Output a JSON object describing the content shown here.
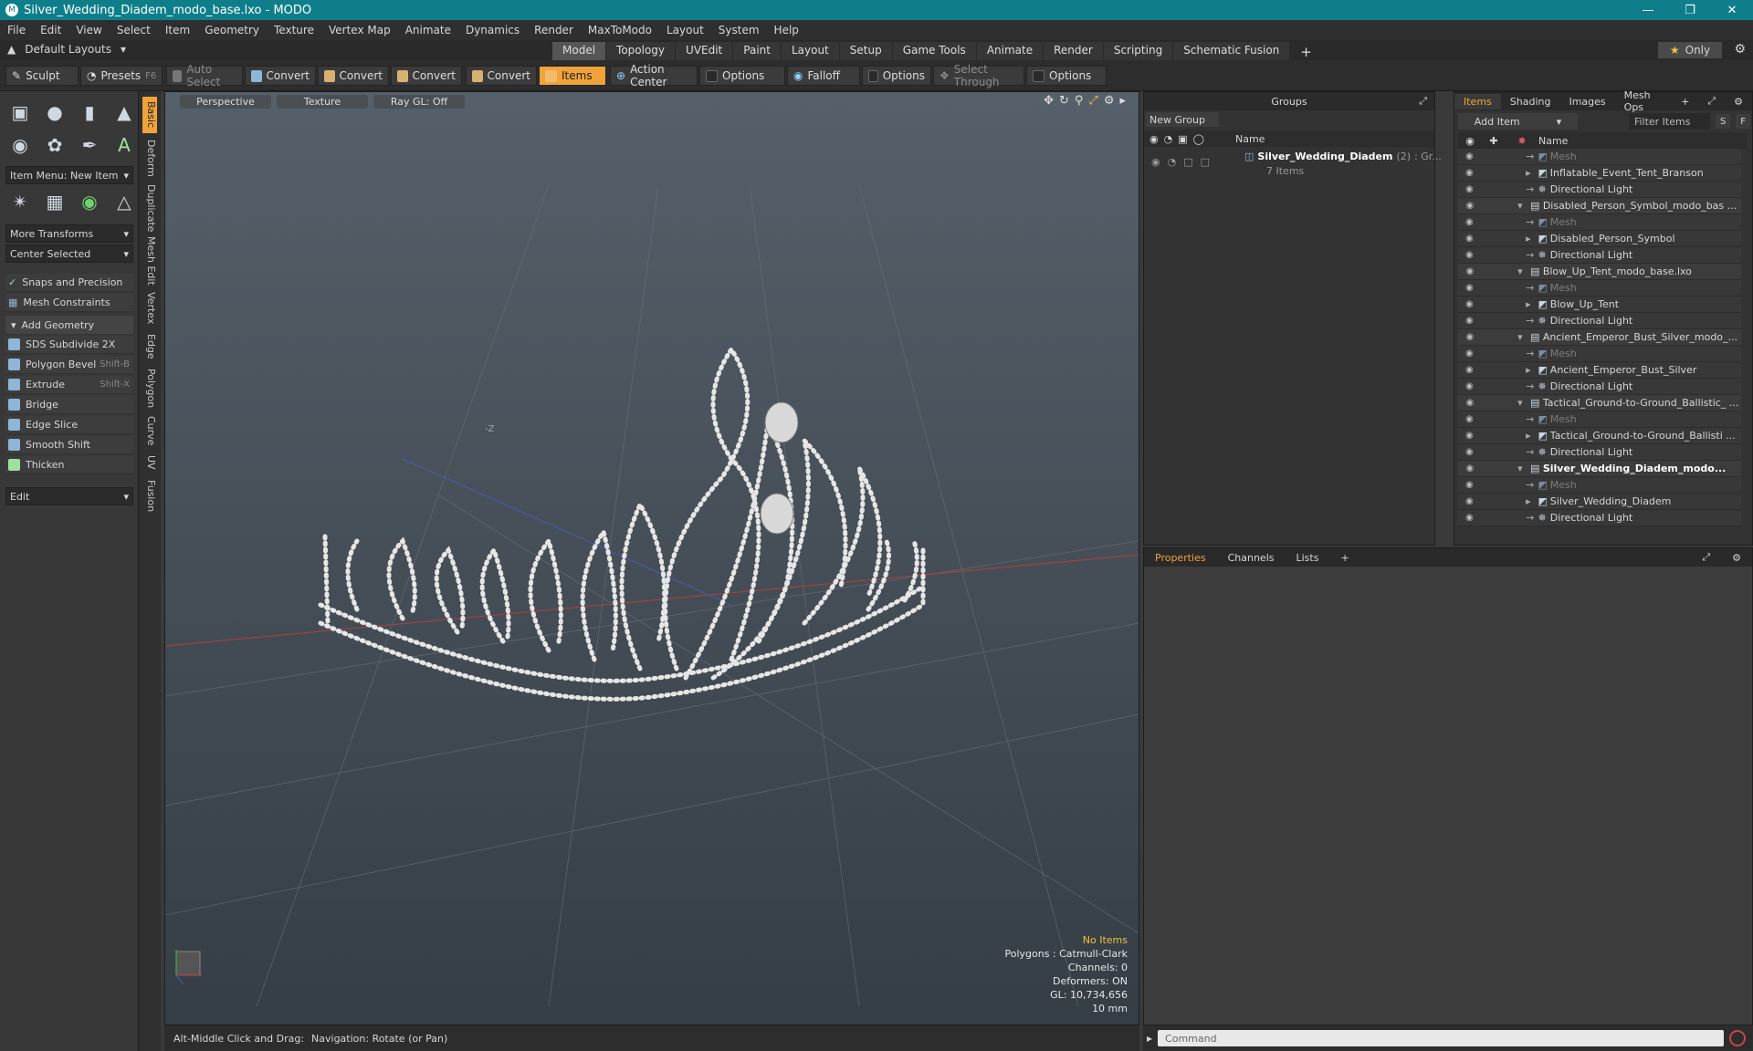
{
  "window": {
    "title": "Silver_Wedding_Diadem_modo_base.lxo - MODO",
    "app_icon": "modo-logo-icon"
  },
  "menu": [
    "File",
    "Edit",
    "View",
    "Select",
    "Item",
    "Geometry",
    "Texture",
    "Vertex Map",
    "Animate",
    "Dynamics",
    "Render",
    "MaxToModo",
    "Layout",
    "System",
    "Help"
  ],
  "layoutbar": {
    "layout_label": "Default Layouts",
    "tabs": [
      "Model",
      "Topology",
      "UVEdit",
      "Paint",
      "Layout",
      "Setup",
      "Game Tools",
      "Animate",
      "Render",
      "Scripting",
      "Schematic Fusion"
    ],
    "active_tab": "Model",
    "add_tab": "+",
    "only_label": "Only"
  },
  "toolbar": {
    "sculpt": "Sculpt",
    "presets": "Presets",
    "presets_key": "F6",
    "auto_select": "Auto Select",
    "convert": "Convert",
    "items": "Items",
    "action_center": "Action Center",
    "options": "Options",
    "falloff": "Falloff",
    "select_through": "Select Through"
  },
  "left": {
    "item_menu": "Item Menu: New Item",
    "more_transforms": "More Transforms",
    "center_selected": "Center Selected",
    "snaps": "Snaps and Precision",
    "mesh_constraints": "Mesh Constraints",
    "add_geometry": "Add Geometry",
    "tools": [
      {
        "label": "SDS Subdivide 2X",
        "shortcut": ""
      },
      {
        "label": "Polygon Bevel",
        "shortcut": "Shift-B"
      },
      {
        "label": "Extrude",
        "shortcut": "Shift-X"
      },
      {
        "label": "Bridge",
        "shortcut": ""
      },
      {
        "label": "Edge Slice",
        "shortcut": ""
      },
      {
        "label": "Smooth Shift",
        "shortcut": ""
      },
      {
        "label": "Thicken",
        "shortcut": ""
      }
    ],
    "edit": "Edit"
  },
  "vtabs": [
    "Basic",
    "Deform",
    "Duplicate",
    "Mesh Edit",
    "Vertex",
    "Edge",
    "Polygon",
    "Curve",
    "UV",
    "Fusion"
  ],
  "viewport": {
    "view": "Perspective",
    "shading": "Texture",
    "raygl": "Ray GL: Off",
    "axis_label": "-Z",
    "info": {
      "no_items": "No Items",
      "polygons": "Polygons : Catmull-Clark",
      "channels": "Channels: 0",
      "deformers": "Deformers: ON",
      "gl": "GL: 10,734,656",
      "scale": "10 mm"
    }
  },
  "status": {
    "hint": "Alt-Middle Click and Drag:",
    "nav": "Navigation: Rotate (or Pan)"
  },
  "groups": {
    "header": "Groups",
    "new_group": "New Group",
    "name_col": "Name",
    "row_name": "Silver_Wedding_Diadem",
    "row_count": "(2)",
    "row_type": ": Gr...",
    "row_sub": "7 Items"
  },
  "items": {
    "tabs": [
      "Items",
      "Shading",
      "Images",
      "Mesh Ops"
    ],
    "add_tab": "+",
    "add_item": "Add Item",
    "filter": "Filter Items",
    "s_btn": "S",
    "f_btn": "F",
    "name_col": "Name",
    "rows": [
      {
        "name": "Mesh",
        "kind": "mesh",
        "dim": true
      },
      {
        "name": "Inflatable_Event_Tent_Branson",
        "kind": "item"
      },
      {
        "name": "Directional Light",
        "kind": "light"
      },
      {
        "name": "Disabled_Person_Symbol_modo_bas ...",
        "kind": "scene"
      },
      {
        "name": "Mesh",
        "kind": "mesh",
        "dim": true
      },
      {
        "name": "Disabled_Person_Symbol",
        "kind": "item"
      },
      {
        "name": "Directional Light",
        "kind": "light"
      },
      {
        "name": "Blow_Up_Tent_modo_base.lxo",
        "kind": "scene"
      },
      {
        "name": "Mesh",
        "kind": "mesh",
        "dim": true
      },
      {
        "name": "Blow_Up_Tent",
        "kind": "item"
      },
      {
        "name": "Directional Light",
        "kind": "light"
      },
      {
        "name": "Ancient_Emperor_Bust_Silver_modo_...",
        "kind": "scene"
      },
      {
        "name": "Mesh",
        "kind": "mesh",
        "dim": true
      },
      {
        "name": "Ancient_Emperor_Bust_Silver",
        "kind": "item"
      },
      {
        "name": "Directional Light",
        "kind": "light"
      },
      {
        "name": "Tactical_Ground-to-Ground_Ballistic_ ...",
        "kind": "scene"
      },
      {
        "name": "Mesh",
        "kind": "mesh",
        "dim": true
      },
      {
        "name": "Tactical_Ground-to-Ground_Ballisti ...",
        "kind": "item"
      },
      {
        "name": "Directional Light",
        "kind": "light"
      },
      {
        "name": "Silver_Wedding_Diadem_modo...",
        "kind": "scene",
        "bold": true
      },
      {
        "name": "Mesh",
        "kind": "mesh",
        "dim": true
      },
      {
        "name": "Silver_Wedding_Diadem",
        "kind": "item"
      },
      {
        "name": "Directional Light",
        "kind": "light"
      }
    ]
  },
  "props": {
    "tabs": [
      "Properties",
      "Channels",
      "Lists"
    ],
    "add_tab": "+"
  },
  "command": {
    "placeholder": "Command"
  }
}
